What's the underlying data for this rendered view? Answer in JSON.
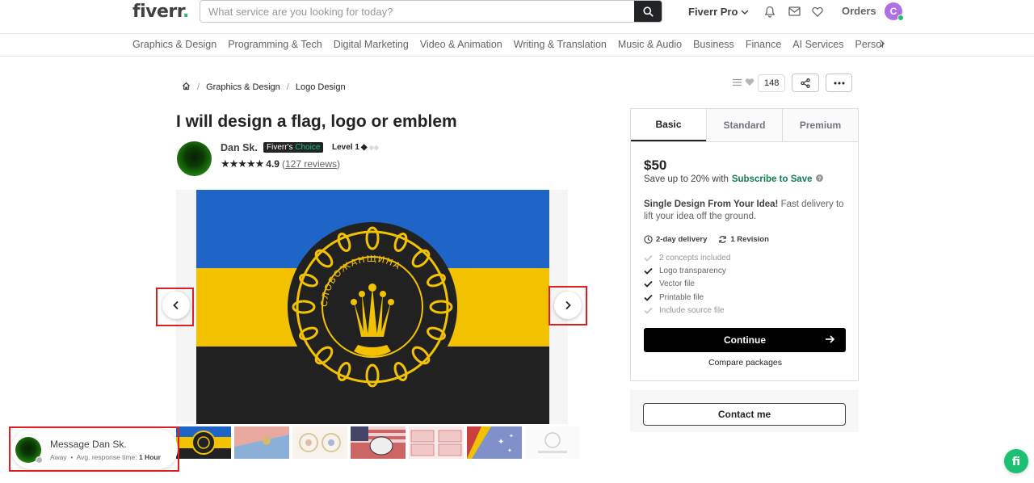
{
  "header": {
    "logo_text": "fiverr",
    "logo_dot": ".",
    "search_placeholder": "What service are you looking for today?",
    "pro_label": "Fiverr Pro",
    "orders_label": "Orders",
    "avatar_initial": "C"
  },
  "categories": [
    "Graphics & Design",
    "Programming & Tech",
    "Digital Marketing",
    "Video & Animation",
    "Writing & Translation",
    "Music & Audio",
    "Business",
    "Finance",
    "AI Services",
    "Personal Growth"
  ],
  "breadcrumb": {
    "sep": "/",
    "items": [
      "Graphics & Design",
      "Logo Design"
    ]
  },
  "actions": {
    "likes": "148"
  },
  "gig": {
    "title": "I will design a flag, logo or emblem",
    "seller_name": "Dan Sk.",
    "badge_prefix": "Fiverr's",
    "badge_accent": "Choice",
    "level": "Level 1",
    "stars": "★★★★★",
    "rating": "4.9",
    "reviews": "127 reviews",
    "emblem_text": "СЛОБОЖАНЩИНА"
  },
  "message": {
    "title": "Message Dan Sk.",
    "status": "Away",
    "dot": "•",
    "response_label": "Avg. response time:",
    "response_value": "1 Hour"
  },
  "package": {
    "tabs": [
      "Basic",
      "Standard",
      "Premium"
    ],
    "active_tab": "Basic",
    "price": "$50",
    "save_text": "Save up to 20% with",
    "save_link": "Subscribe to Save",
    "desc_title": "Single Design From Your Idea!",
    "desc_text": "Fast delivery to lift your idea off the ground.",
    "delivery": "2-day delivery",
    "revisions": "1 Revision",
    "features": [
      {
        "label": "2 concepts included",
        "included": false
      },
      {
        "label": "Logo transparency",
        "included": true
      },
      {
        "label": "Vector file",
        "included": true
      },
      {
        "label": "Printable file",
        "included": true
      },
      {
        "label": "Include source file",
        "included": false
      }
    ],
    "continue_label": "Continue",
    "compare_label": "Compare packages",
    "contact_label": "Contact me"
  },
  "colors": {
    "brand_green": "#1dbf73",
    "flag_blue": "#1f65c8",
    "flag_yellow": "#f2c200",
    "flag_black": "#212121",
    "highlight_red": "#e02020"
  }
}
